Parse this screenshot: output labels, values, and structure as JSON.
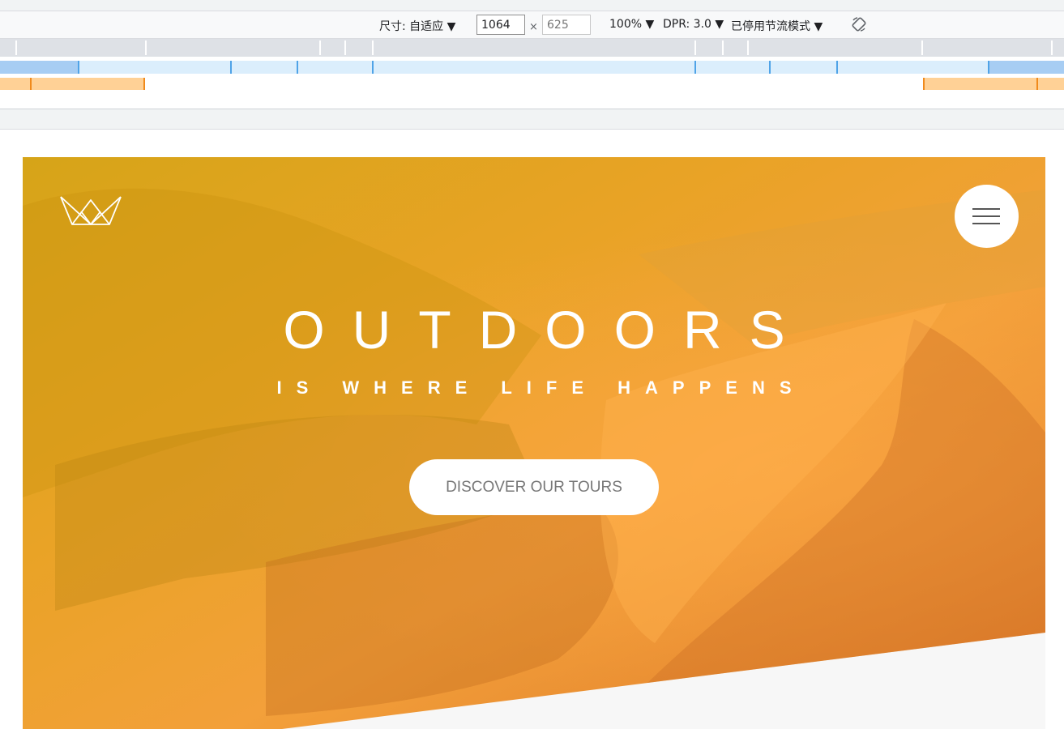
{
  "devtools": {
    "size_label": "尺寸: 自适应 ▼",
    "width_value": "1064",
    "height_placeholder": "625",
    "times": "×",
    "zoom": "100% ▼",
    "dpr": "DPR: 3.0 ▼",
    "throttle": "已停用节流模式 ▼",
    "rotate_icon": "rotate-icon"
  },
  "hero": {
    "logo_icon": "crown-icon",
    "menu_icon": "hamburger-menu-icon",
    "title": "OUTDOORS",
    "subtitle": "IS WHERE LIFE HAPPENS",
    "cta_label": "DISCOVER OUR TOURS",
    "gradient_colors": [
      "#d6a418",
      "#f3a03a",
      "#dc7628"
    ]
  }
}
